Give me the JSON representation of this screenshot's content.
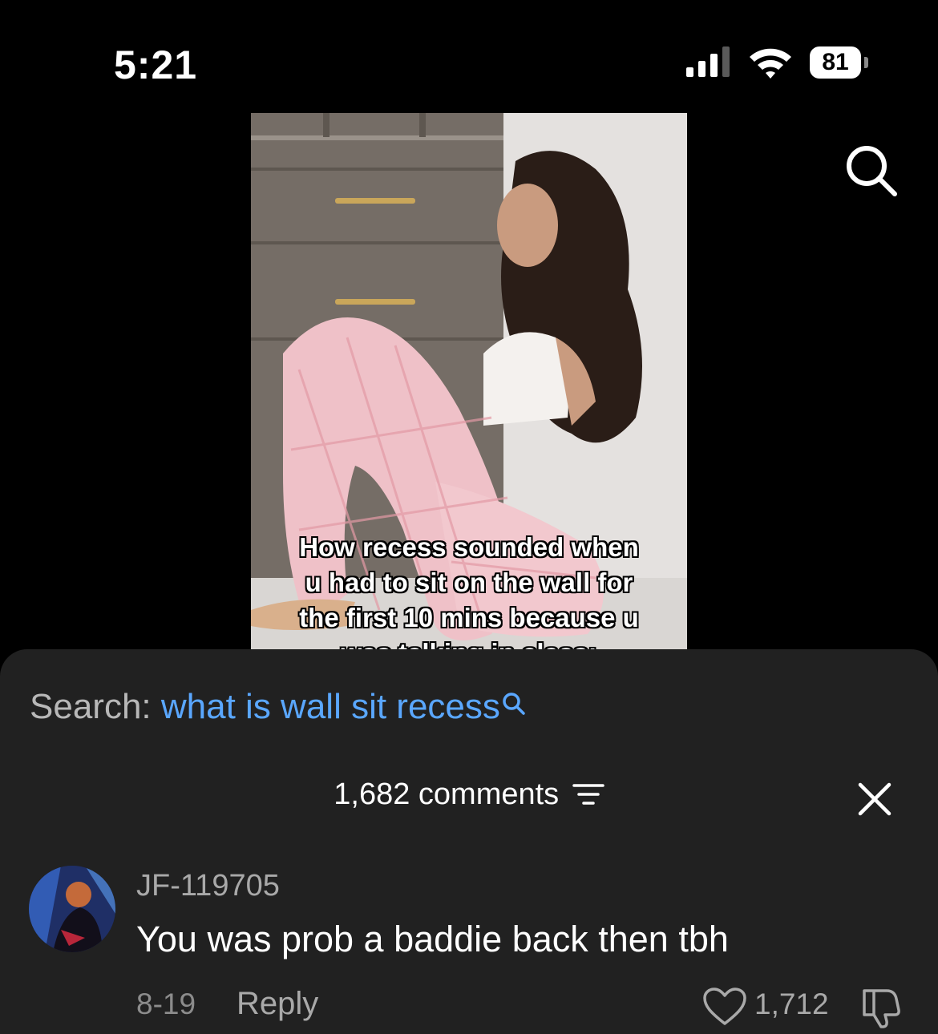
{
  "status_bar": {
    "time": "5:21",
    "battery": "81"
  },
  "video": {
    "caption_lines": [
      "How recess sounded when",
      "u had to sit on the wall for",
      "the first 10 mins because u",
      "was talking in class:"
    ]
  },
  "search": {
    "label": "Search:",
    "term": "what is wall sit recess"
  },
  "comments_panel": {
    "count_label": "1,682 comments"
  },
  "comment": {
    "username": "JF-119705",
    "text": "You was prob a baddie back then tbh",
    "date": "8-19",
    "reply_label": "Reply",
    "likes": "1,712"
  },
  "colors": {
    "accent_link": "#5aa7ff",
    "sheet_bg": "#212121"
  },
  "icons": [
    "signal-icon",
    "wifi-icon",
    "battery-icon",
    "search-icon",
    "filter-icon",
    "close-icon",
    "heart-icon",
    "dislike-icon"
  ]
}
